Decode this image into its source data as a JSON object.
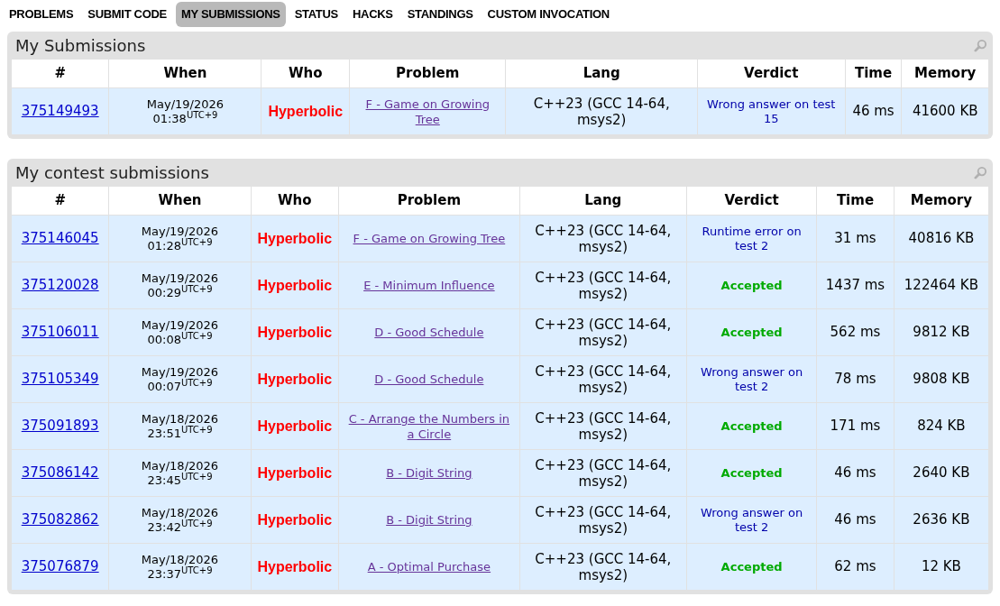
{
  "nav": [
    {
      "label": "PROBLEMS",
      "selected": false
    },
    {
      "label": "SUBMIT CODE",
      "selected": false
    },
    {
      "label": "MY SUBMISSIONS",
      "selected": true
    },
    {
      "label": "STATUS",
      "selected": false
    },
    {
      "label": "HACKS",
      "selected": false
    },
    {
      "label": "STANDINGS",
      "selected": false
    },
    {
      "label": "CUSTOM INVOCATION",
      "selected": false
    }
  ],
  "panels": [
    {
      "title": "My Submissions",
      "columns": [
        "#",
        "When",
        "Who",
        "Problem",
        "Lang",
        "Verdict",
        "Time",
        "Memory"
      ],
      "rows": [
        {
          "id": "375149493",
          "date": "May/19/2026",
          "time": "01:38",
          "tz": "UTC+9",
          "who": "Hyperbolic",
          "problem": "F - Game on Growing Tree",
          "lang": "C++23 (GCC 14-64, msys2)",
          "verdict": "Wrong answer on test 15",
          "accepted": false,
          "run_time": "46 ms",
          "memory": "41600 KB"
        }
      ]
    },
    {
      "title": "My contest submissions",
      "columns": [
        "#",
        "When",
        "Who",
        "Problem",
        "Lang",
        "Verdict",
        "Time",
        "Memory"
      ],
      "rows": [
        {
          "id": "375146045",
          "date": "May/19/2026",
          "time": "01:28",
          "tz": "UTC+9",
          "who": "Hyperbolic",
          "problem": "F - Game on Growing Tree",
          "lang": "C++23 (GCC 14-64, msys2)",
          "verdict": "Runtime error on test 2",
          "accepted": false,
          "run_time": "31 ms",
          "memory": "40816 KB"
        },
        {
          "id": "375120028",
          "date": "May/19/2026",
          "time": "00:29",
          "tz": "UTC+9",
          "who": "Hyperbolic",
          "problem": "E - Minimum Influence",
          "lang": "C++23 (GCC 14-64, msys2)",
          "verdict": "Accepted",
          "accepted": true,
          "run_time": "1437 ms",
          "memory": "122464 KB"
        },
        {
          "id": "375106011",
          "date": "May/19/2026",
          "time": "00:08",
          "tz": "UTC+9",
          "who": "Hyperbolic",
          "problem": "D - Good Schedule",
          "lang": "C++23 (GCC 14-64, msys2)",
          "verdict": "Accepted",
          "accepted": true,
          "run_time": "562 ms",
          "memory": "9812 KB"
        },
        {
          "id": "375105349",
          "date": "May/19/2026",
          "time": "00:07",
          "tz": "UTC+9",
          "who": "Hyperbolic",
          "problem": "D - Good Schedule",
          "lang": "C++23 (GCC 14-64, msys2)",
          "verdict": "Wrong answer on test 2",
          "accepted": false,
          "run_time": "78 ms",
          "memory": "9808 KB"
        },
        {
          "id": "375091893",
          "date": "May/18/2026",
          "time": "23:51",
          "tz": "UTC+9",
          "who": "Hyperbolic",
          "problem": "C - Arrange the Numbers in a Circle",
          "lang": "C++23 (GCC 14-64, msys2)",
          "verdict": "Accepted",
          "accepted": true,
          "run_time": "171 ms",
          "memory": "824 KB"
        },
        {
          "id": "375086142",
          "date": "May/18/2026",
          "time": "23:45",
          "tz": "UTC+9",
          "who": "Hyperbolic",
          "problem": "B - Digit String",
          "lang": "C++23 (GCC 14-64, msys2)",
          "verdict": "Accepted",
          "accepted": true,
          "run_time": "46 ms",
          "memory": "2640 KB"
        },
        {
          "id": "375082862",
          "date": "May/18/2026",
          "time": "23:42",
          "tz": "UTC+9",
          "who": "Hyperbolic",
          "problem": "B - Digit String",
          "lang": "C++23 (GCC 14-64, msys2)",
          "verdict": "Wrong answer on test 2",
          "accepted": false,
          "run_time": "46 ms",
          "memory": "2636 KB"
        },
        {
          "id": "375076879",
          "date": "May/18/2026",
          "time": "23:37",
          "tz": "UTC+9",
          "who": "Hyperbolic",
          "problem": "A - Optimal Purchase",
          "lang": "C++23 (GCC 14-64, msys2)",
          "verdict": "Accepted",
          "accepted": true,
          "run_time": "62 ms",
          "memory": "12 KB"
        }
      ]
    }
  ]
}
